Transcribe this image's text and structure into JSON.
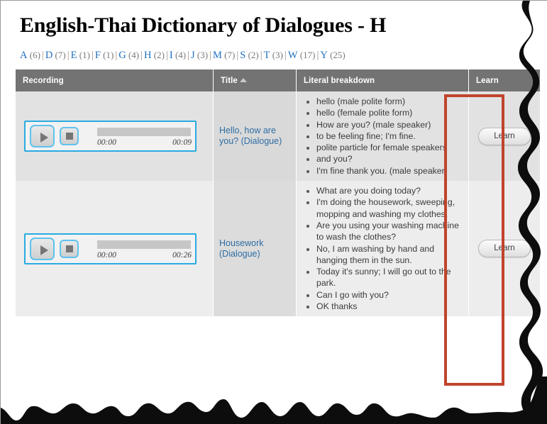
{
  "header": {
    "title": "English-Thai Dictionary of Dialogues - H"
  },
  "alpha_nav": {
    "separator": "|",
    "items": [
      {
        "letter": "A",
        "count": "(6)"
      },
      {
        "letter": "D",
        "count": "(7)"
      },
      {
        "letter": "E",
        "count": "(1)"
      },
      {
        "letter": "F",
        "count": "(1)"
      },
      {
        "letter": "G",
        "count": "(4)"
      },
      {
        "letter": "H",
        "count": "(2)"
      },
      {
        "letter": "I",
        "count": "(4)"
      },
      {
        "letter": "J",
        "count": "(3)"
      },
      {
        "letter": "M",
        "count": "(7)"
      },
      {
        "letter": "S",
        "count": "(2)"
      },
      {
        "letter": "T",
        "count": "(3)"
      },
      {
        "letter": "W",
        "count": "(17)"
      },
      {
        "letter": "Y",
        "count": "(25)"
      }
    ]
  },
  "table": {
    "columns": [
      {
        "label": "Recording",
        "sorted": false
      },
      {
        "label": "Title",
        "sorted": true,
        "sort_direction": "ascending",
        "sort_icon": "triangle-up-icon"
      },
      {
        "label": "Literal breakdown",
        "sorted": false
      },
      {
        "label": "Learn",
        "sorted": false
      }
    ],
    "rows": [
      {
        "player": {
          "play_icon": "play-icon",
          "stop_icon": "stop-icon",
          "time_current": "00:00",
          "time_total": "00:09"
        },
        "title": "Hello, how are you? (Dialogue)",
        "literal_breakdown": [
          "hello (male polite form)",
          "hello (female polite form)",
          "How are you? (male speaker)",
          "to be feeling fine; I'm fine.",
          "polite particle for female speakers",
          "and you?",
          "I'm fine thank you. (male speaker)"
        ],
        "learn_label": "Learn"
      },
      {
        "player": {
          "play_icon": "play-icon",
          "stop_icon": "stop-icon",
          "time_current": "00:00",
          "time_total": "00:26"
        },
        "title": "Housework (Dialogue)",
        "literal_breakdown": [
          "What are you doing today?",
          "I'm doing the housework, sweeping, mopping and washing my clothes.",
          "Are you using your washing machine to wash the clothes?",
          "No, I am washing by hand and hanging them in the sun.",
          "Today it's sunny; I will go out to the park.",
          "Can I go with you?",
          "OK thanks"
        ],
        "learn_label": "Learn"
      }
    ]
  },
  "annotation": {
    "highlight_box_color": "#c0442c",
    "highlight_target": "learn-column"
  },
  "colors": {
    "header_bg": "#737373",
    "link": "#2e6da4",
    "nav_link": "#1f6fbf",
    "row_a_bg": "#e2e2e2",
    "row_b_bg": "#ededed",
    "player_border": "#29abe2"
  }
}
